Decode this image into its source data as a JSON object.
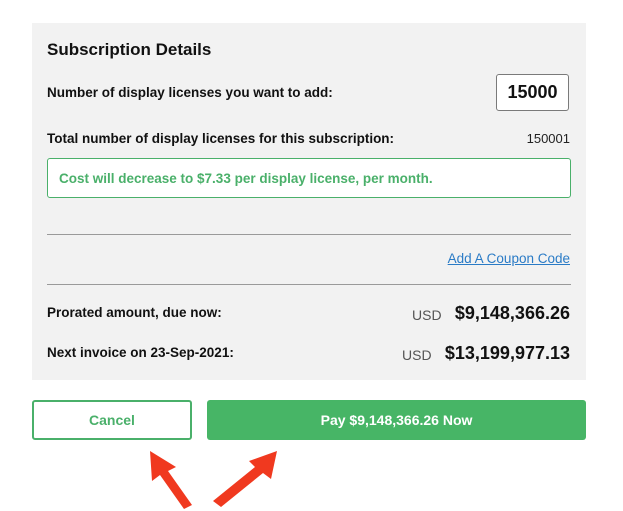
{
  "subscription": {
    "title": "Subscription Details",
    "add_licenses_label": "Number of display licenses you want to add:",
    "add_licenses_value": "15000",
    "total_licenses_label": "Total number of display licenses for this subscription:",
    "total_licenses_value": "150001",
    "notice": "Cost will decrease to $7.33 per display license, per month.",
    "coupon_link": "Add A Coupon Code",
    "prorated_label": "Prorated amount, due now:",
    "prorated_currency": "USD",
    "prorated_amount": "$9,148,366.26",
    "next_invoice_label": "Next invoice on 23-Sep-2021:",
    "next_invoice_currency": "USD",
    "next_invoice_amount": "$13,199,977.13"
  },
  "actions": {
    "cancel_label": "Cancel",
    "pay_label": "Pay $9,148,366.26 Now"
  },
  "colors": {
    "accent_green": "#47b566",
    "link_blue": "#2a7bc6",
    "annotation_arrow": "#f0391f",
    "panel_background": "#f2f2f2"
  },
  "annotations": {
    "arrow_icons": [
      "arrow-icon",
      "arrow-icon"
    ]
  }
}
